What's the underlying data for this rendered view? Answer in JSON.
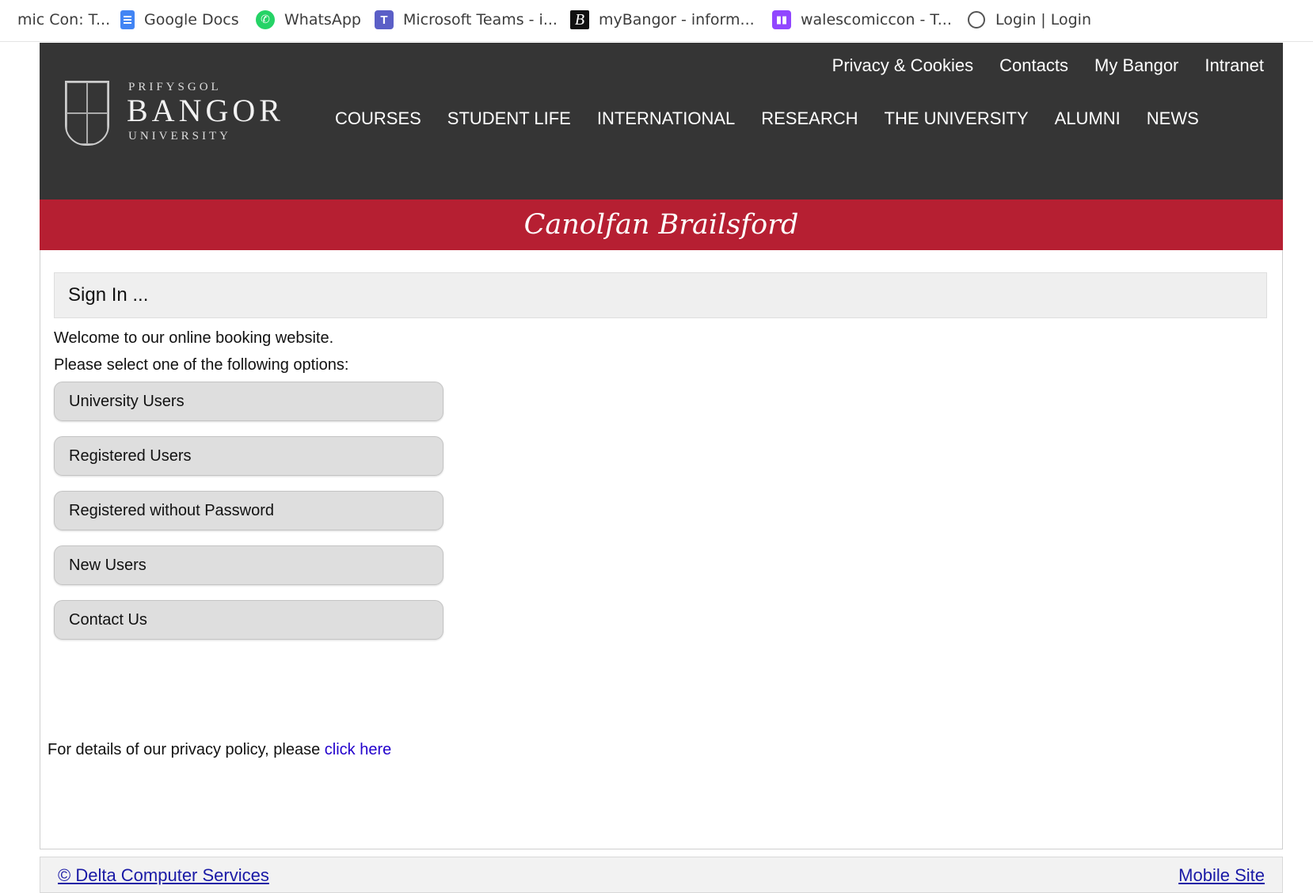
{
  "bookmarks": [
    {
      "label": "mic Con: T...",
      "icon": "none"
    },
    {
      "label": "Google Docs",
      "icon": "google-docs-icon"
    },
    {
      "label": "WhatsApp",
      "icon": "whatsapp-icon"
    },
    {
      "label": "Microsoft Teams - i...",
      "icon": "teams-icon"
    },
    {
      "label": "myBangor - inform...",
      "icon": "mybangor-icon"
    },
    {
      "label": "walescomiccon - T...",
      "icon": "twitch-icon"
    },
    {
      "label": "Login | Login",
      "icon": "login-icon"
    }
  ],
  "logo": {
    "top": "PRIFYSGOL",
    "main": "BANGOR",
    "bottom": "UNIVERSITY"
  },
  "top_links": [
    "Privacy & Cookies",
    "Contacts",
    "My Bangor",
    "Intranet"
  ],
  "main_nav": [
    "COURSES",
    "STUDENT LIFE",
    "INTERNATIONAL",
    "RESEARCH",
    "THE UNIVERSITY",
    "ALUMNI",
    "NEWS"
  ],
  "banner_title": "Canolfan Brailsford",
  "signin_heading": "Sign In ...",
  "intro": [
    "Welcome to our online booking website.",
    "Please select one of the following options:"
  ],
  "options": [
    "University Users",
    "Registered Users",
    "Registered without Password",
    "New Users",
    "Contact Us"
  ],
  "privacy": {
    "text": "For details of our privacy policy, please ",
    "link": "click here"
  },
  "footer": {
    "left_link": "© Delta Computer Services",
    "right_link": "Mobile Site"
  },
  "colors": {
    "header_bg": "#353535",
    "banner_bg": "#b61f32",
    "option_bg": "#dedede"
  }
}
